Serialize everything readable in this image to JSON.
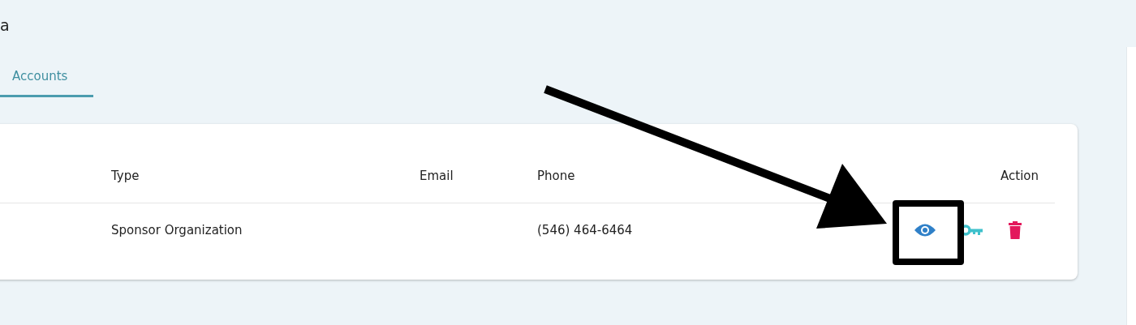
{
  "page_title": "a",
  "tabs": [
    {
      "label": "Accounts",
      "selected": true
    }
  ],
  "table": {
    "columns": [
      "Type",
      "Email",
      "Phone",
      "Action"
    ],
    "rows": [
      {
        "type": "Sponsor Organization",
        "phone": "(546) 464-6464"
      }
    ]
  }
}
